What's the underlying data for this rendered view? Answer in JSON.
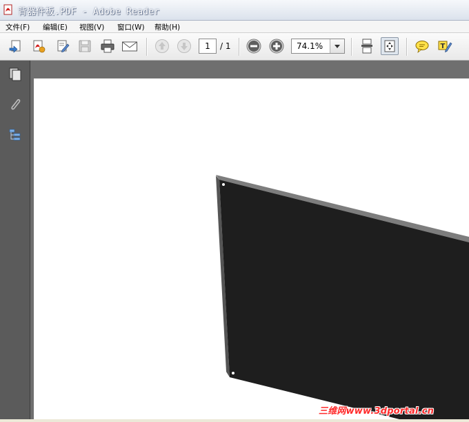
{
  "window": {
    "title": "背器件板.PDF - Adobe Reader"
  },
  "menu": [
    {
      "label": "文件(F)"
    },
    {
      "label": "编辑(E)"
    },
    {
      "label": "视图(V)"
    },
    {
      "label": "窗口(W)"
    },
    {
      "label": "帮助(H)"
    }
  ],
  "toolbar": {
    "page_current": "1",
    "page_total": "/ 1",
    "zoom": "74.1%"
  },
  "watermark": "三维网www.3dportal.cn",
  "colors": {
    "panel": "#1e1e1e",
    "panel_edge": "#7d7d7d",
    "watermark": "#ff2a2a",
    "nav_bg": "#5b5b5b",
    "doc_bg": "#6f6f6f"
  }
}
